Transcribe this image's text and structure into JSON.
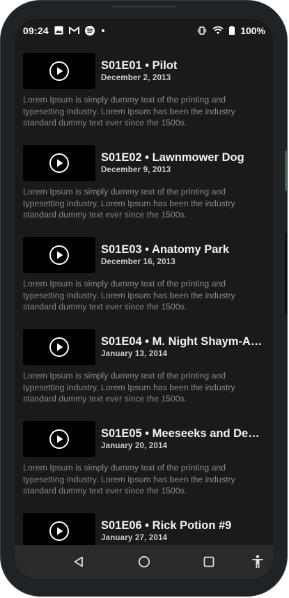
{
  "status_bar": {
    "time": "09:24",
    "battery": "100%",
    "icons": [
      "image-icon",
      "gmail-icon",
      "spotify-icon",
      "dot-icon",
      "vibrate-icon",
      "wifi-icon",
      "battery-icon"
    ]
  },
  "episodes": [
    {
      "title": "S01E01 • Pilot",
      "date": "December 2, 2013",
      "description": "Lorem Ipsum is simply dummy text of the printing and typesetting industry. Lorem Ipsum has been the industry standard dummy text ever since the 1500s."
    },
    {
      "title": "S01E02 • Lawnmower Dog",
      "date": "December 9, 2013",
      "description": "Lorem Ipsum is simply dummy text of the printing and typesetting industry. Lorem Ipsum has been the industry standard dummy text ever since the 1500s."
    },
    {
      "title": "S01E03 • Anatomy Park",
      "date": "December 16, 2013",
      "description": "Lorem Ipsum is simply dummy text of the printing and typesetting industry. Lorem Ipsum has been the industry standard dummy text ever since the 1500s."
    },
    {
      "title": "S01E04 • M. Night Shaym-A…",
      "date": "January 13, 2014",
      "description": "Lorem Ipsum is simply dummy text of the printing and typesetting industry. Lorem Ipsum has been the industry standard dummy text ever since the 1500s."
    },
    {
      "title": "S01E05 • Meeseeks and De…",
      "date": "January 20, 2014",
      "description": "Lorem Ipsum is simply dummy text of the printing and typesetting industry. Lorem Ipsum has been the industry standard dummy text ever since the 1500s."
    },
    {
      "title": "S01E06 • Rick Potion #9",
      "date": "January 27, 2014",
      "description": ""
    }
  ],
  "nav": {
    "buttons": [
      "back-icon",
      "home-icon",
      "recents-icon",
      "accessibility-icon"
    ]
  },
  "colors": {
    "background": "#1a1a1a",
    "thumbnail": "#000000",
    "title": "#f2f2f2",
    "description": "#8a8a8a",
    "navbar": "#2a2a2a"
  }
}
